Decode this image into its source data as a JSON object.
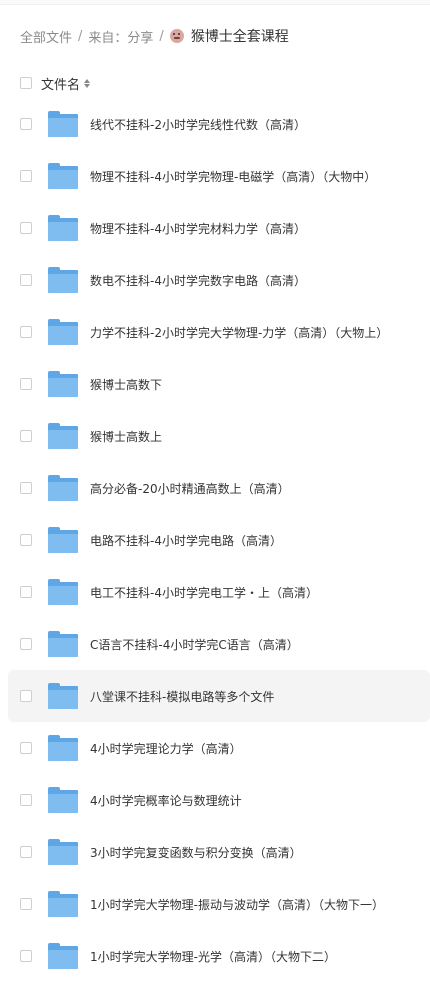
{
  "breadcrumb": {
    "root": "全部文件",
    "sep": "/",
    "from": "来自：分享",
    "current": "猴博士全套课程"
  },
  "header": {
    "column_label": "文件名"
  },
  "files": [
    {
      "name": "线代不挂科-2小时学完线性代数（高清）"
    },
    {
      "name": "物理不挂科-4小时学完物理-电磁学（高清）（大物中）"
    },
    {
      "name": "物理不挂科-4小时学完材料力学（高清）"
    },
    {
      "name": "数电不挂科-4小时学完数字电路（高清）"
    },
    {
      "name": "力学不挂科-2小时学完大学物理-力学（高清）（大物上）"
    },
    {
      "name": "猴博士高数下"
    },
    {
      "name": "猴博士高数上"
    },
    {
      "name": "高分必备-20小时精通高数上（高清）"
    },
    {
      "name": "电路不挂科-4小时学完电路（高清）"
    },
    {
      "name": "电工不挂科-4小时学完电工学・上（高清）"
    },
    {
      "name": "C语言不挂科-4小时学完C语言（高清）"
    },
    {
      "name": "八堂课不挂科-模拟电路等多个文件"
    },
    {
      "name": "4小时学完理论力学（高清）"
    },
    {
      "name": "4小时学完概率论与数理统计"
    },
    {
      "name": "3小时学完复变函数与积分变换（高清）"
    },
    {
      "name": "1小时学完大学物理-振动与波动学（高清）（大物下一）"
    },
    {
      "name": "1小时学完大学物理-光学（高清）（大物下二）"
    }
  ]
}
